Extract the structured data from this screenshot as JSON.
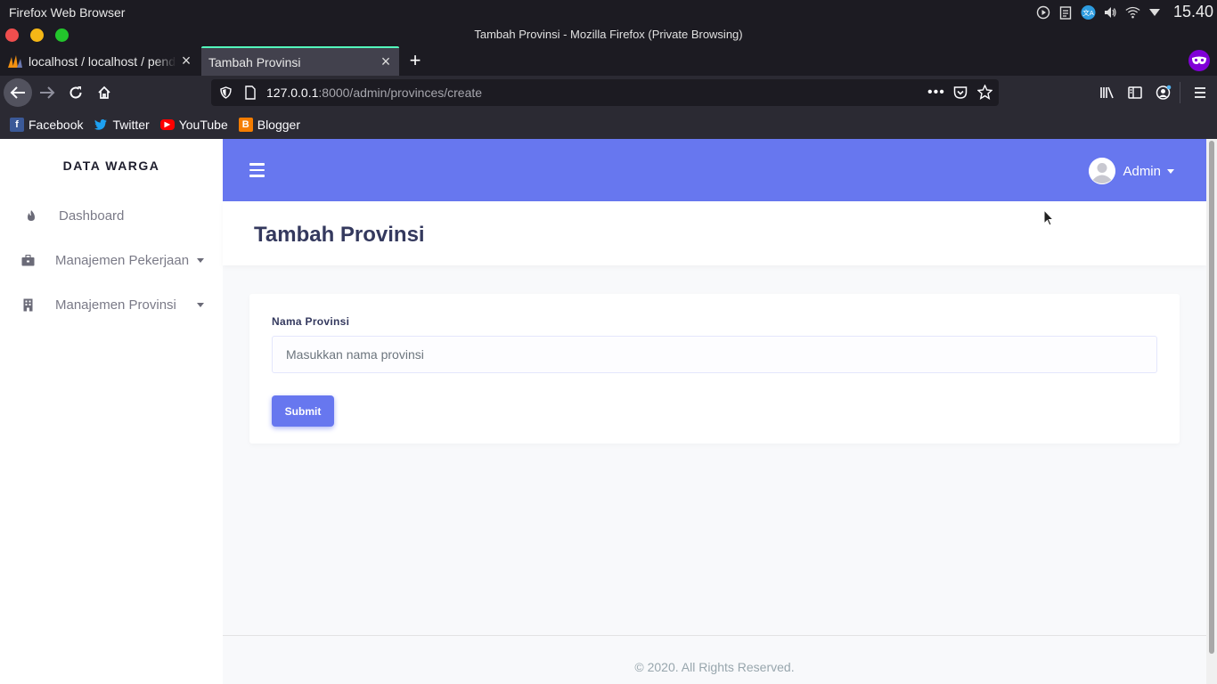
{
  "os": {
    "app_title": "Firefox Web Browser",
    "clock": "15.40"
  },
  "window": {
    "title": "Tambah Provinsi - Mozilla Firefox (Private Browsing)"
  },
  "tabs": [
    {
      "label": "localhost / localhost / pendataan"
    },
    {
      "label": "Tambah Provinsi"
    }
  ],
  "address_bar": {
    "host": "127.0.0.1",
    "path": ":8000/admin/provinces/create"
  },
  "bookmarks": [
    {
      "label": "Facebook",
      "icon": "facebook-icon",
      "color": "#3b5998"
    },
    {
      "label": "Twitter",
      "icon": "twitter-icon",
      "color": "#1da1f2"
    },
    {
      "label": "YouTube",
      "icon": "youtube-icon",
      "color": "#ff0000"
    },
    {
      "label": "Blogger",
      "icon": "blogger-icon",
      "color": "#f57d00"
    }
  ],
  "sidebar": {
    "brand": "DATA WARGA",
    "items": [
      {
        "label": "Dashboard",
        "icon": "fire-icon"
      },
      {
        "label": "Manajemen Pekerjaan",
        "icon": "briefcase-icon"
      },
      {
        "label": "Manajemen Provinsi",
        "icon": "building-icon"
      }
    ]
  },
  "topbar": {
    "user_name": "Admin",
    "accent": "#6777ef"
  },
  "main": {
    "page_title": "Tambah Provinsi",
    "form": {
      "label": "Nama Provinsi",
      "placeholder": "Masukkan nama provinsi",
      "value": "",
      "submit_label": "Submit"
    }
  },
  "footer": {
    "text": "© 2020. All Rights Reserved."
  }
}
